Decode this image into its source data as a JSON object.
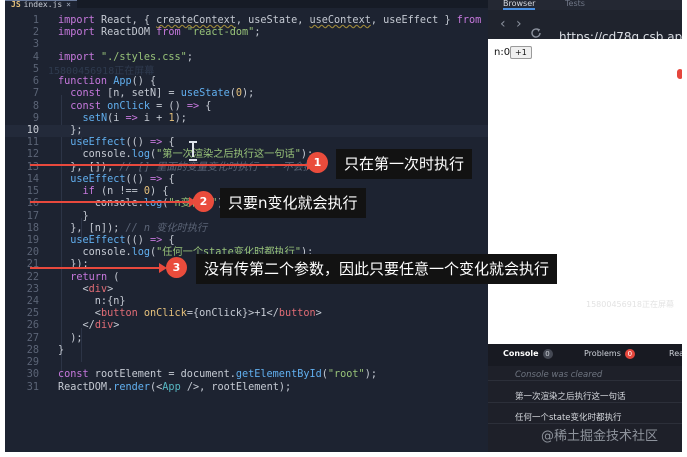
{
  "editor": {
    "tab_label": "index.js",
    "tab_icon": "JS",
    "close_glyph": "×",
    "ghost_watermark": "15800456918正在屏幕",
    "lines": [
      {
        "n": "1",
        "html": "<span class=\"k\">import</span> React, { <span class=\"u\">createContext</span>, useState, <span class=\"u\">useContext</span>, useEffect } <span class=\"k\">from</span> <span class=\"s\">\"react\"</span>;"
      },
      {
        "n": "2",
        "html": "<span class=\"k\">import</span> ReactDOM <span class=\"k\">from</span> <span class=\"s\">\"react-dom\"</span>;"
      },
      {
        "n": "3",
        "html": ""
      },
      {
        "n": "4",
        "html": "<span class=\"k\">import</span> <span class=\"s\">\"./styles.css\"</span>;"
      },
      {
        "n": "5",
        "html": ""
      },
      {
        "n": "6",
        "html": "<span class=\"k\">function</span> <span class=\"f\">App</span>() {"
      },
      {
        "n": "7",
        "html": "  <span class=\"k\">const</span> [n, setN] = <span class=\"f\">useState</span>(<span class=\"n\">0</span>);"
      },
      {
        "n": "8",
        "html": "  <span class=\"k\">const</span> <span class=\"f\">onClick</span> = () <span class=\"k\">=&gt;</span> {"
      },
      {
        "n": "9",
        "html": "    <span class=\"f\">setN</span>(i <span class=\"k\">=&gt;</span> i + <span class=\"n\">1</span>);"
      },
      {
        "n": "10",
        "html": "  };",
        "active": true
      },
      {
        "n": "11",
        "html": "  <span class=\"f\">useEffect</span>(() <span class=\"k\">=&gt;</span> {"
      },
      {
        "n": "12",
        "html": "    console.<span class=\"f\">log</span>(<span class=\"s\">\"第一次渲染之后执行这一句话\"</span>);"
      },
      {
        "n": "13",
        "html": "  }, []); <span class=\"c\">// [] 里面的变量变化时执行 -- 不会执行</span>"
      },
      {
        "n": "14",
        "html": "  <span class=\"f\">useEffect</span>(() <span class=\"k\">=&gt;</span> {"
      },
      {
        "n": "15",
        "html": "    <span class=\"k\">if</span> (n !== <span class=\"n\">0</span>) {"
      },
      {
        "n": "16",
        "html": "      console.<span class=\"f\">log</span>(<span class=\"s\">\"n变化了\"</span>);"
      },
      {
        "n": "17",
        "html": "    }"
      },
      {
        "n": "18",
        "html": "  }, [n]); <span class=\"c\">// n 变化时执行</span>"
      },
      {
        "n": "19",
        "html": "  <span class=\"f\">useEffect</span>(() <span class=\"k\">=&gt;</span> {"
      },
      {
        "n": "20",
        "html": "    console.<span class=\"f\">log</span>(<span class=\"s\">\"任何一个state变化时都执行\"</span>);"
      },
      {
        "n": "21",
        "html": "  });"
      },
      {
        "n": "22",
        "html": "  <span class=\"k\">return</span> ("
      },
      {
        "n": "23",
        "html": "    &lt;<span class=\"v\">div</span>&gt;"
      },
      {
        "n": "24",
        "html": "      n:{n}"
      },
      {
        "n": "25",
        "html": "      &lt;<span class=\"v\">button</span> <span class=\"n\">onClick</span>={onClick}&gt;+1&lt;/<span class=\"v\">button</span>&gt;"
      },
      {
        "n": "26",
        "html": "    &lt;/<span class=\"v\">div</span>&gt;"
      },
      {
        "n": "27",
        "html": "  );"
      },
      {
        "n": "28",
        "html": "}"
      },
      {
        "n": "29",
        "html": ""
      },
      {
        "n": "30",
        "html": "<span class=\"k\">const</span> rootElement = document.<span class=\"f\">getElementById</span>(<span class=\"s\">\"root\"</span>);"
      },
      {
        "n": "31",
        "html": "ReactDOM.<span class=\"f\">render</span>(&lt;<span class=\"w\">App</span> /&gt;, rootElement);"
      }
    ]
  },
  "browser": {
    "tabs": [
      "Browser",
      "Tests"
    ],
    "back_glyph": "‹",
    "forward_glyph": "›",
    "url": "https://cd78q.csb.app/",
    "preview": {
      "counter_text": "n:0",
      "button_label": "+1",
      "watermark": "15800456918正在屏幕"
    }
  },
  "console": {
    "tabs": [
      {
        "label": "Console",
        "count": "0"
      },
      {
        "label": "Problems",
        "count": "0"
      },
      {
        "label": "Rea"
      }
    ],
    "cleared_text": "Console was cleared",
    "logs": [
      "第一次渲染之后执行这一句话",
      "任何一个state变化时都执行"
    ]
  },
  "annotations": [
    {
      "number": "1",
      "text": "只在第一次时执行"
    },
    {
      "number": "2",
      "text": "只要n变化就会执行"
    },
    {
      "number": "3",
      "text": "没有传第二个参数，因此只要任意一个变化就会执行"
    }
  ],
  "watermark": "@稀土掘金技术社区",
  "colors": {
    "editor_bg": "#1d2331",
    "annotation_red": "#e8493d",
    "note_bg": "#121212",
    "keyword": "#c678dd",
    "function": "#61afef",
    "string": "#98c379",
    "number": "#e5c07b"
  }
}
